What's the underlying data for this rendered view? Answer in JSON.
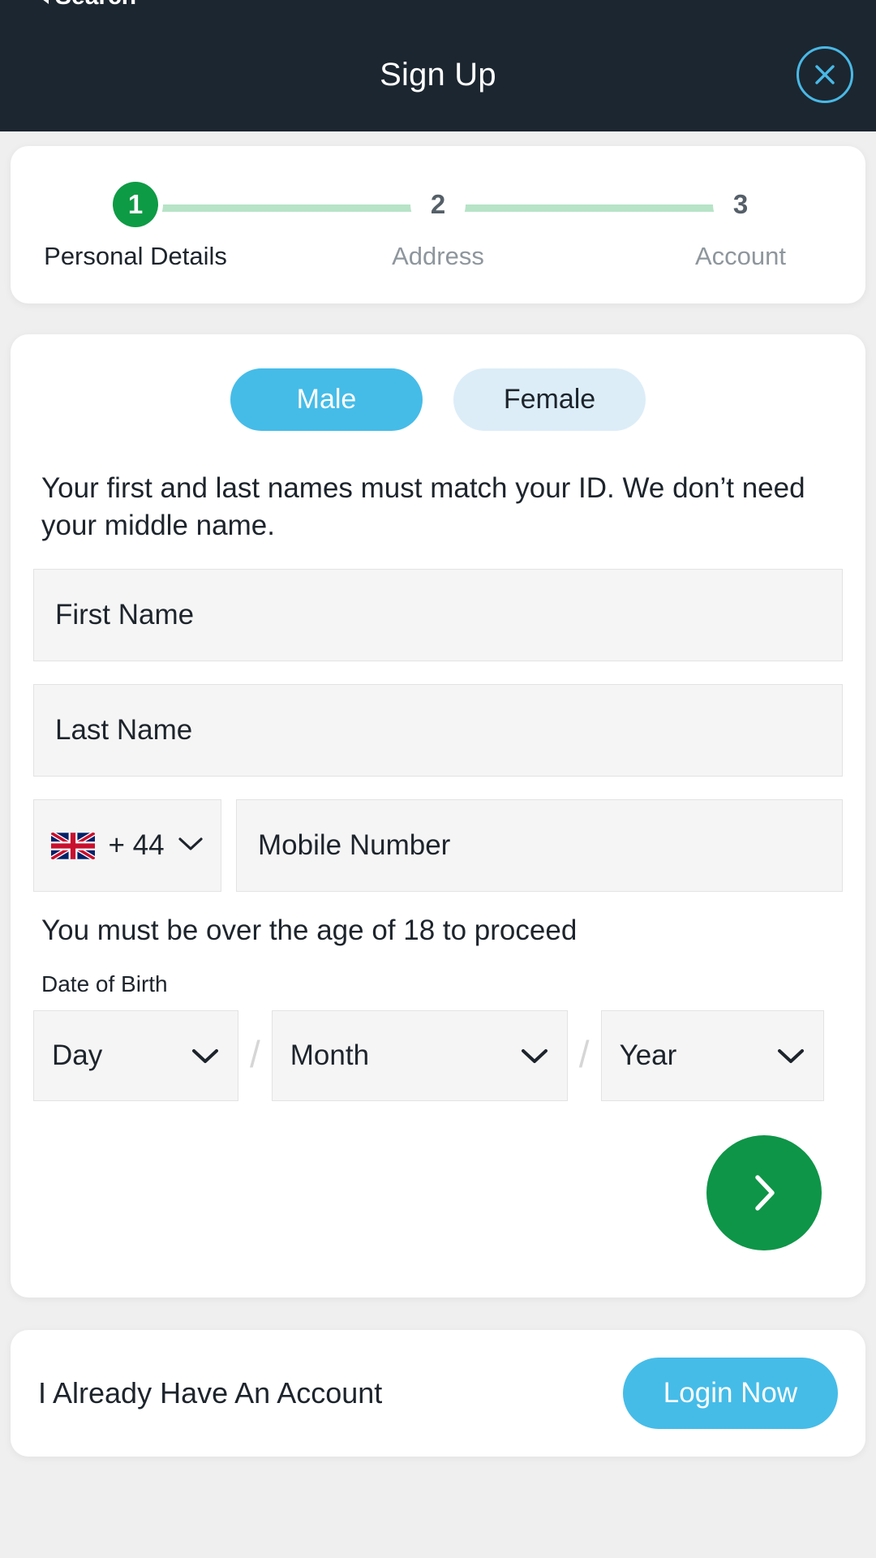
{
  "statusbar": {
    "back_label": "Search"
  },
  "header": {
    "title": "Sign Up",
    "close_icon": "close-circle-icon",
    "background": "#1c2630",
    "accent": "#49b9e6"
  },
  "stepper": {
    "active_color": "#0e9b45",
    "line_color": "#b7e3c7",
    "steps": [
      {
        "number": "1",
        "label": "Personal Details",
        "state": "active"
      },
      {
        "number": "2",
        "label": "Address",
        "state": "inactive"
      },
      {
        "number": "3",
        "label": "Account",
        "state": "inactive"
      }
    ]
  },
  "form": {
    "gender": {
      "selected": "Male",
      "options": [
        {
          "label": "Male",
          "state": "selected"
        },
        {
          "label": "Female",
          "state": "unselected"
        }
      ],
      "selected_color": "#45bce8",
      "unselected_color": "#dcedf8"
    },
    "name_helper": "Your first and last names must match your ID. We don’t need your middle name.",
    "first_name": {
      "value": "",
      "placeholder": "First Name"
    },
    "last_name": {
      "value": "",
      "placeholder": "Last Name"
    },
    "phone": {
      "flag_icon": "uk-flag-icon",
      "dial_code": "+ 44",
      "chevron_icon": "chevron-down-icon",
      "number": {
        "value": "",
        "placeholder": "Mobile Number"
      }
    },
    "age_note": "You must be over the age of 18 to proceed",
    "dob": {
      "label": "Date of Birth",
      "separator": "/",
      "day": {
        "value": "Day",
        "placeholder": "Day"
      },
      "month": {
        "value": "Month",
        "placeholder": "Month"
      },
      "year": {
        "value": "Year",
        "placeholder": "Year"
      }
    },
    "next_button": {
      "icon": "chevron-right-icon",
      "color": "#0e9548"
    }
  },
  "login": {
    "prompt": "I Already Have An Account",
    "button_label": "Login Now",
    "button_color": "#45bce8"
  }
}
